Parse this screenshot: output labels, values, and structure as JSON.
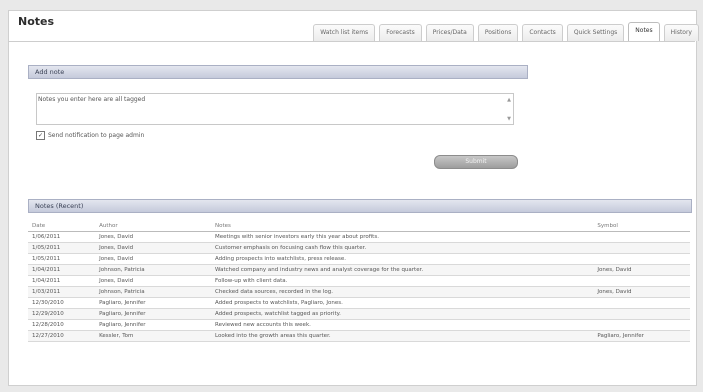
{
  "header": {
    "title": "Notes"
  },
  "tabs": [
    {
      "label": "Watch list items",
      "active": false
    },
    {
      "label": "Forecasts",
      "active": false
    },
    {
      "label": "Prices/Data",
      "active": false
    },
    {
      "label": "Positions",
      "active": false
    },
    {
      "label": "Contacts",
      "active": false
    },
    {
      "label": "Quick Settings",
      "active": false
    },
    {
      "label": "Notes",
      "active": true
    },
    {
      "label": "History",
      "active": false
    }
  ],
  "add_note": {
    "header": "Add note",
    "instruction": "Notes you enter here are all tagged",
    "textarea_value": "",
    "checkbox_label": "Send notification to page admin",
    "checkbox_checked": true,
    "submit_label": "Submit"
  },
  "recent": {
    "header": "Notes (Recent)",
    "columns": [
      "Date",
      "Author",
      "Notes",
      "Symbol"
    ],
    "rows": [
      {
        "date": "1/06/2011",
        "author": "Jones, David",
        "note": "Meetings with senior investors early this year about profits.",
        "symbol": ""
      },
      {
        "date": "1/05/2011",
        "author": "Jones, David",
        "note": "Customer emphasis on focusing cash flow this quarter.",
        "symbol": ""
      },
      {
        "date": "1/05/2011",
        "author": "Jones, David",
        "note": "Adding prospects into watchlists, press release.",
        "symbol": ""
      },
      {
        "date": "1/04/2011",
        "author": "Johnson, Patricia",
        "note": "Watched company and industry news and analyst coverage for the quarter.",
        "symbol": "Jones, David"
      },
      {
        "date": "1/04/2011",
        "author": "Jones, David",
        "note": "Follow-up with client data.",
        "symbol": ""
      },
      {
        "date": "1/03/2011",
        "author": "Johnson, Patricia",
        "note": "Checked data sources, recorded in the log.",
        "symbol": "Jones, David"
      },
      {
        "date": "12/30/2010",
        "author": "Pagliaro, Jennifer",
        "note": "Added prospects to watchlists, Pagliaro, Jones.",
        "symbol": ""
      },
      {
        "date": "12/29/2010",
        "author": "Pagliaro, Jennifer",
        "note": "Added prospects, watchlist tagged as priority.",
        "symbol": ""
      },
      {
        "date": "12/28/2010",
        "author": "Pagliaro, Jennifer",
        "note": "Reviewed new accounts this week.",
        "symbol": ""
      },
      {
        "date": "12/27/2010",
        "author": "Kessler, Tom",
        "note": "Looked into the growth areas this quarter.",
        "symbol": "Pagliaro, Jennifer"
      }
    ]
  }
}
